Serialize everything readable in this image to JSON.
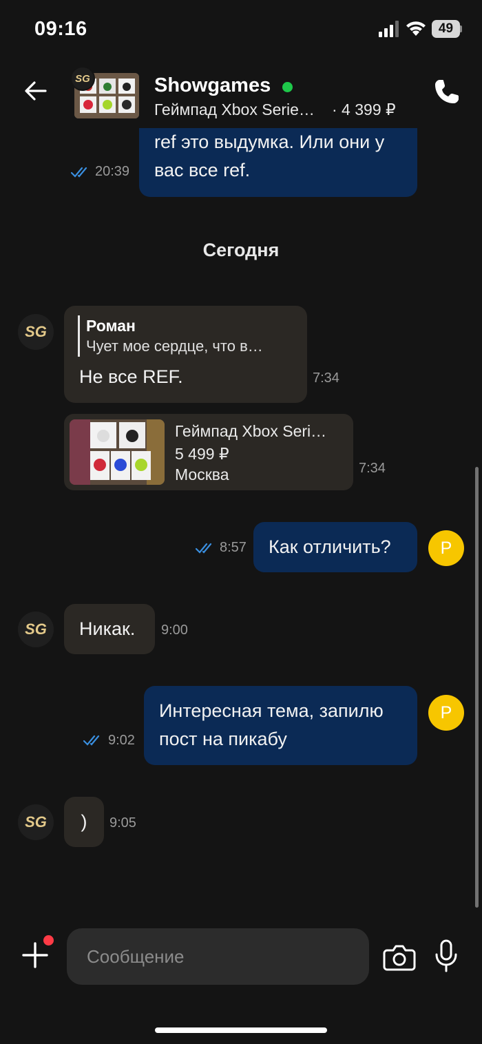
{
  "status_bar": {
    "time": "09:16",
    "battery": "49"
  },
  "header": {
    "title": "Showgames",
    "subtitle": "Геймпад Xbox Serie…",
    "price": "· 4 399 ₽"
  },
  "messages": {
    "prev_out": {
      "text": "ref это выдумка. Или они у вас все ref.",
      "time": "20:39"
    },
    "date_separator": "Сегодня",
    "reply": {
      "quote_name": "Роман",
      "quote_text": "Чует мое сердце, что в…",
      "text": "Не все REF.",
      "time": "7:34"
    },
    "product": {
      "title": "Геймпад Xbox Seri…",
      "price": "5 499 ₽",
      "city": "Москва",
      "time": "7:34"
    },
    "out1": {
      "text": "Как отличить?",
      "time": "8:57"
    },
    "in1": {
      "text": "Никак.",
      "time": "9:00"
    },
    "out2": {
      "text": "Интересная тема, запилю пост на пикабу",
      "time": "9:02"
    },
    "in2": {
      "text": ")",
      "time": "9:05"
    }
  },
  "user_avatar_letter": "Р",
  "shop_logo": "SG",
  "input": {
    "placeholder": "Сообщение"
  },
  "colors": {
    "outgoing": "#0b2a55",
    "incoming": "#2b2824",
    "online": "#1ec84a",
    "avatar": "#f7c600"
  }
}
